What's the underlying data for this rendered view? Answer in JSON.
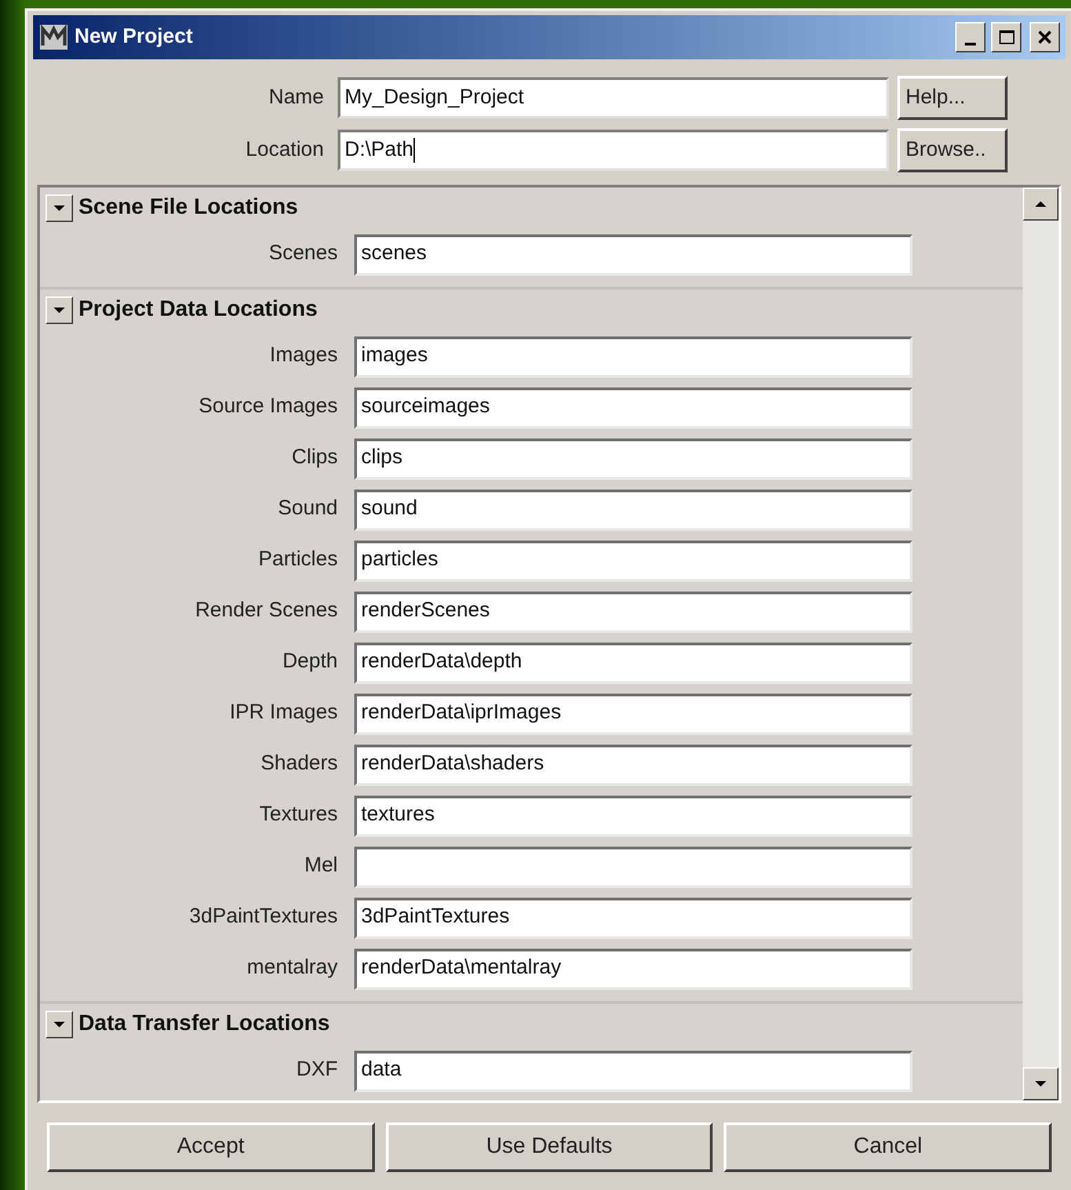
{
  "window": {
    "title": "New Project"
  },
  "top_fields": [
    {
      "label": "Name",
      "value": "My_Design_Project",
      "focused": false,
      "button": "Help..."
    },
    {
      "label": "Location",
      "value": "D:\\Path",
      "focused": true,
      "button": "Browse.."
    }
  ],
  "sections": [
    {
      "title": "Scene File Locations",
      "expanded": true,
      "fields": [
        {
          "label": "Scenes",
          "value": "scenes"
        }
      ]
    },
    {
      "title": "Project Data Locations",
      "expanded": true,
      "fields": [
        {
          "label": "Images",
          "value": "images"
        },
        {
          "label": "Source Images",
          "value": "sourceimages"
        },
        {
          "label": "Clips",
          "value": "clips"
        },
        {
          "label": "Sound",
          "value": "sound"
        },
        {
          "label": "Particles",
          "value": "particles"
        },
        {
          "label": "Render Scenes",
          "value": "renderScenes"
        },
        {
          "label": "Depth",
          "value": "renderData\\depth"
        },
        {
          "label": "IPR Images",
          "value": "renderData\\iprImages"
        },
        {
          "label": "Shaders",
          "value": "renderData\\shaders"
        },
        {
          "label": "Textures",
          "value": "textures"
        },
        {
          "label": "Mel"
        },
        {
          "label": "3dPaintTextures",
          "value": "3dPaintTextures"
        },
        {
          "label": "mentalray",
          "value": "renderData\\mentalray"
        }
      ]
    },
    {
      "title": "Data Transfer Locations",
      "expanded": true,
      "fields": [
        {
          "label": "DXF",
          "value": "data"
        }
      ]
    }
  ],
  "buttons": [
    "Accept",
    "Use Defaults",
    "Cancel"
  ]
}
